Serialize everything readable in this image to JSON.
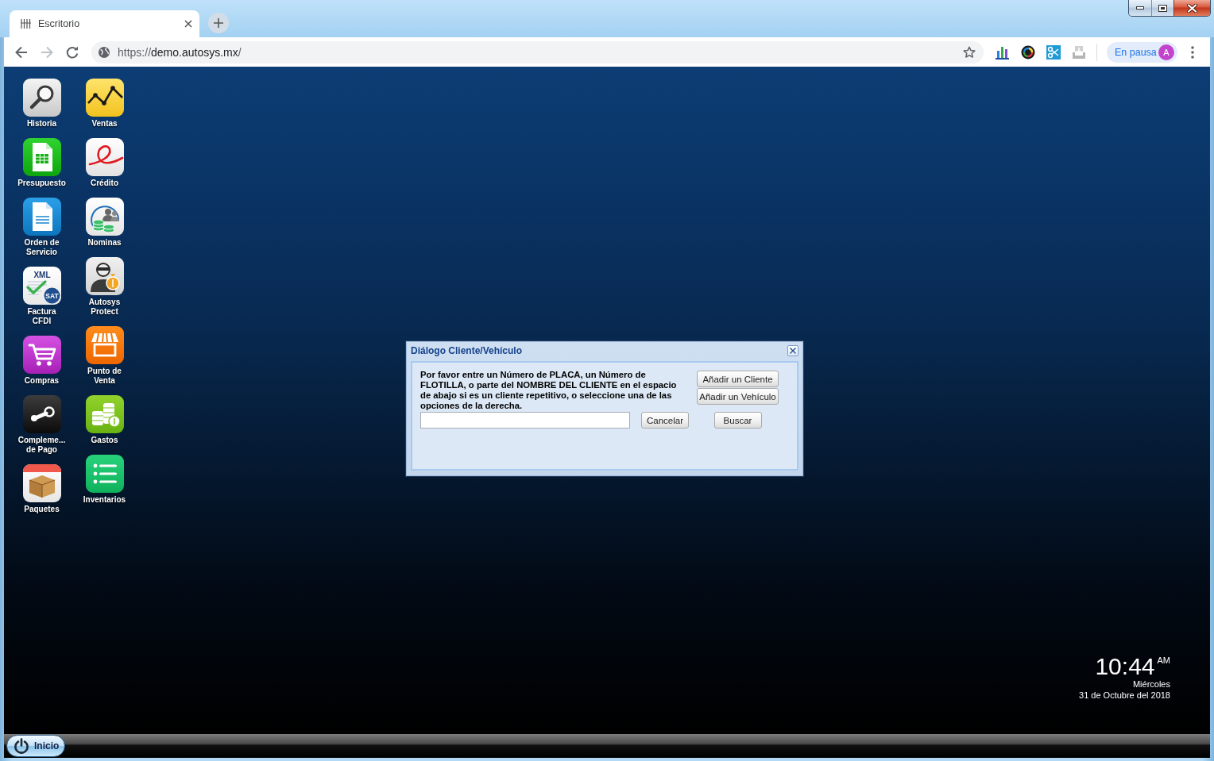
{
  "browser": {
    "tab": {
      "title": "Escritorio",
      "selected": true
    },
    "address": {
      "scheme": "https://",
      "host": "demo.autosys.mx",
      "path": "/"
    },
    "profile": {
      "label": "En pausa",
      "avatar": "A"
    }
  },
  "desktop": {
    "shortcut_columns": [
      {
        "shortcuts": [
          {
            "label": "Historia",
            "kind": "magnifier"
          },
          {
            "label": "Presupuesto",
            "kind": "spreadsheet"
          },
          {
            "label": "Orden de\nServicio",
            "kind": "document"
          },
          {
            "label": "Factura\nCFDI",
            "kind": "xml",
            "icon_text": [
              "XML",
              "SAT"
            ]
          },
          {
            "label": "Compras",
            "kind": "cart"
          },
          {
            "label": "Compleme...\nde Pago",
            "kind": "linkage"
          },
          {
            "label": "Paquetes",
            "kind": "package"
          }
        ]
      },
      {
        "shortcuts": [
          {
            "label": "Ventas",
            "kind": "chart"
          },
          {
            "label": "Crédito",
            "kind": "credit"
          },
          {
            "label": "Nominas",
            "kind": "payroll"
          },
          {
            "label": "Autosys\nProtect",
            "kind": "protect"
          },
          {
            "label": "Punto de\nVenta",
            "kind": "store"
          },
          {
            "label": "Gastos",
            "kind": "coins"
          },
          {
            "label": "Inventarios",
            "kind": "list"
          }
        ]
      }
    ],
    "dialog": {
      "title": "Diálogo Cliente/Vehículo",
      "message": "Por favor entre un Número de PLACA, un Número de FLOTILLA, o parte del NOMBRE DEL CLIENTE en el espacio de abajo si es un cliente repetitivo, o seleccione una de las opciones de la derecha.",
      "add_buttons": [
        "Añadir un Cliente",
        "Añadir un Vehículo"
      ],
      "cancel_button": "Cancelar",
      "search_button": "Buscar"
    },
    "clock": {
      "time": "10:44",
      "period": "AM",
      "weekday": "Miércoles",
      "date": "31 de Octubre del 2018"
    }
  },
  "taskbar": {
    "start_button": "Inicio"
  }
}
